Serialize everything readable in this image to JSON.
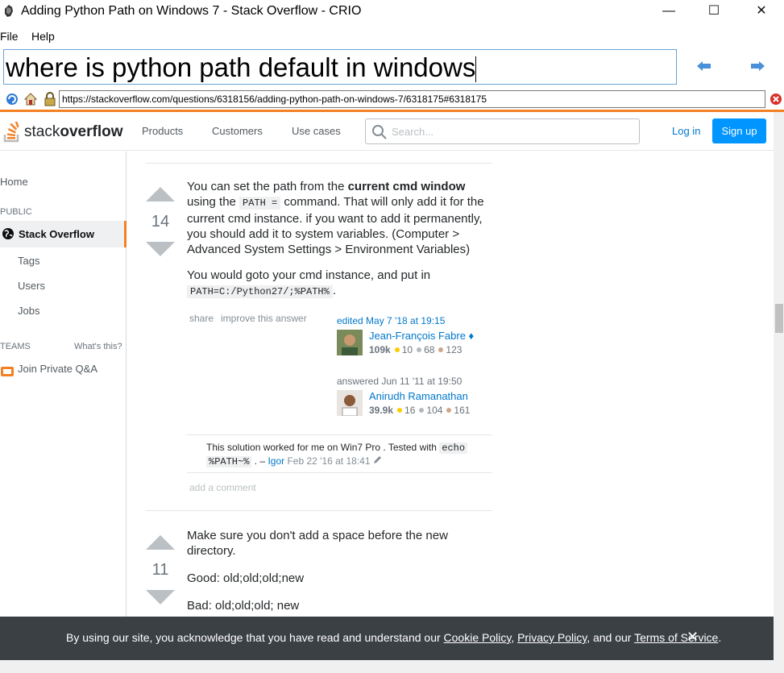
{
  "window": {
    "title": "Adding Python Path on Windows 7 - Stack Overflow - CRIO",
    "minimize": "—",
    "maximize": "☐",
    "close": "✕"
  },
  "menu": {
    "file": "File",
    "help": "Help"
  },
  "query": {
    "value": "where is python path default in windows"
  },
  "url": {
    "value": "https://stackoverflow.com/questions/6318156/adding-python-path-on-windows-7/6318175#6318175"
  },
  "so_header": {
    "logo_prefix": "stack",
    "logo_bold": "overflow",
    "products": "Products",
    "customers": "Customers",
    "use_cases": "Use cases",
    "search_placeholder": "Search...",
    "login": "Log in",
    "signup": "Sign up"
  },
  "sidebar": {
    "home": "Home",
    "public": "PUBLIC",
    "stack_overflow": "Stack Overflow",
    "tags": "Tags",
    "users": "Users",
    "jobs": "Jobs",
    "teams": "TEAMS",
    "whats_this": "What's this?",
    "join_private": "Join Private Q&A"
  },
  "answer1": {
    "votes": "14",
    "p1_a": "You can set the path from the ",
    "p1_bold": "current cmd window",
    "p1_b": "using the ",
    "p1_code": "PATH =",
    "p1_c": " command. That will only add it for the",
    "p1_d": "current cmd instance. if you want to add it permanently,",
    "p1_e": "you should add it to system variables. (Computer >",
    "p1_f": "Advanced System Settings > Environment Variables)",
    "p2_a": "You would goto your cmd instance, and put in",
    "p2_code": "PATH=C:/Python27/;%PATH%",
    "p2_b": ".",
    "share": "share",
    "improve": "improve this answer",
    "edited": "edited May 7 '18 at 19:15",
    "editor_name": "Jean-François Fabre ♦",
    "editor_rep": "109k",
    "editor_gold": "10",
    "editor_silver": "68",
    "editor_bronze": "123",
    "answered": "answered Jun 11 '11 at 19:50",
    "author_name": "Anirudh Ramanathan",
    "author_rep": "39.9k",
    "author_gold": "16",
    "author_silver": "104",
    "author_bronze": "161",
    "comment_a": "This solution worked for me on Win7 Pro . Tested with ",
    "comment_code1": "echo",
    "comment_code2": "%PATH~%",
    "comment_b": " . – ",
    "comment_user": "Igor",
    "comment_date": " Feb 22 '16 at 18:41",
    "add_comment": "add a comment"
  },
  "answer2": {
    "votes": "11",
    "p1": "Make sure you don't add a space before the new",
    "p1b": "directory.",
    "good": "Good: old;old;old;new",
    "bad": "Bad: old;old;old; new"
  },
  "cookie": {
    "text_a": "By using our site, you acknowledge that you have read and understand our ",
    "cookie_policy": "Cookie Policy",
    "comma": ", ",
    "privacy_policy": "Privacy Policy",
    "and": ", and our ",
    "terms": "Terms of Service",
    "period": ".",
    "close": "✕"
  },
  "colors": {
    "accent": "#f48024",
    "link": "#0077cc",
    "button": "#0095ff",
    "gold": "#ffcc01",
    "silver": "#b4b8bc",
    "bronze": "#d1a684"
  }
}
